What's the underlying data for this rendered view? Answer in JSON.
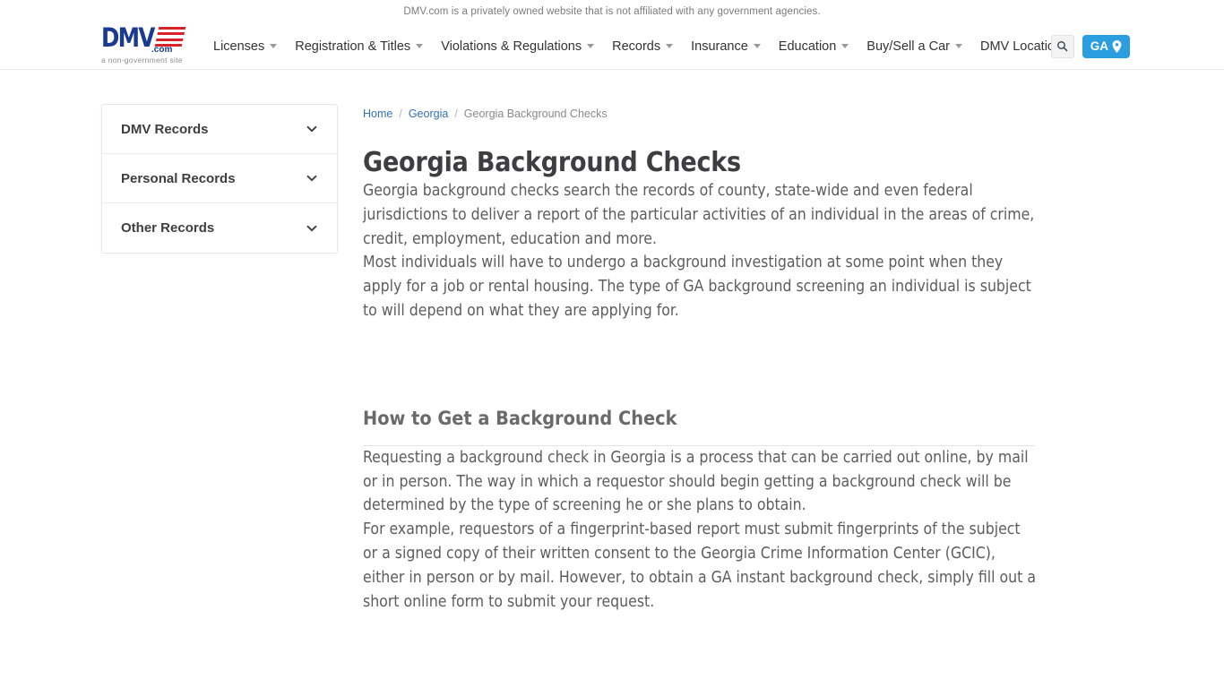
{
  "disclaimer": {
    "text": "DMV.com is a privately owned website that is not affiliated with any government agencies."
  },
  "header": {
    "logo": {
      "brand": "DMV",
      "suffix": ".com",
      "tagline": "a non-government site"
    },
    "nav": [
      {
        "label": "Licenses",
        "has_caret": true
      },
      {
        "label": "Registration & Titles",
        "has_caret": true
      },
      {
        "label": "Violations & Regulations",
        "has_caret": true
      },
      {
        "label": "Records",
        "has_caret": true
      },
      {
        "label": "Insurance",
        "has_caret": true
      },
      {
        "label": "Education",
        "has_caret": true
      },
      {
        "label": "Buy/Sell a Car",
        "has_caret": true
      },
      {
        "label": "DMV Locations",
        "has_caret": false
      }
    ],
    "search_icon": "search-icon",
    "state_button": {
      "label": "GA",
      "icon": "map-pin-icon",
      "color": "#2b9ee0"
    }
  },
  "sidebar": {
    "items": [
      {
        "label": "DMV Records",
        "icon": "chevron-down-icon"
      },
      {
        "label": "Personal Records",
        "icon": "chevron-down-icon"
      },
      {
        "label": "Other Records",
        "icon": "chevron-down-icon"
      }
    ]
  },
  "main": {
    "breadcrumb": {
      "home": "Home",
      "state": "Georgia",
      "current": "Georgia Background Checks",
      "separator": "/"
    },
    "title": "Georgia Background Checks",
    "paragraph1": "Georgia background checks search the records of county, state-wide and even federal jurisdictions to deliver a report of the particular activities of an individual in the areas of crime, credit, employment, education and more.",
    "paragraph2": "Most individuals will have to undergo a background investigation at some point when they apply for a job or rental housing. The type of GA background screening an individual is subject to will depend on what they are applying for.",
    "section_heading": "How to Get a Background Check",
    "paragraph3": "Requesting a background check in Georgia is a process that can be carried out online, by mail or in person. The way in which a requestor should begin getting a background check will be determined by the type of screening he or she plans to obtain.",
    "paragraph4": "For example, requestors of a fingerprint-based report must submit fingerprints of the subject or a signed copy of their written consent to the Georgia Crime Information Center (GCIC), either in person or by mail. However, to obtain a GA instant background check, simply fill out a short online form to submit your request."
  },
  "colors": {
    "link": "#3273b5",
    "accent": "#2b9ee0",
    "logo_blue": "#1a3a8f",
    "logo_red": "#d8232a",
    "text": "#5d5d5d"
  }
}
